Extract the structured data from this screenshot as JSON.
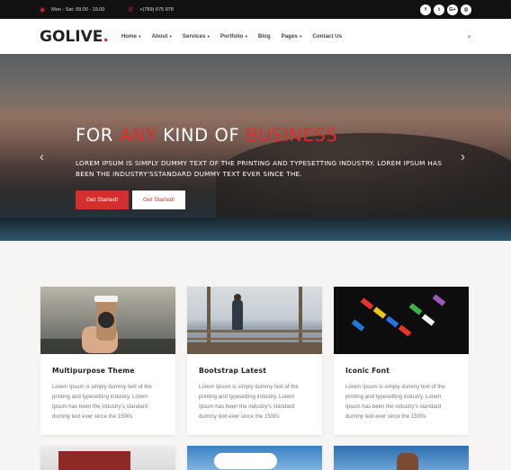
{
  "topbar": {
    "hours": "Mon - Sat: 09.00 - 19.00",
    "phone": "+(789) 675 978",
    "social": [
      {
        "icon": "facebook-icon",
        "glyph": "f"
      },
      {
        "icon": "twitter-icon",
        "glyph": "t"
      },
      {
        "icon": "google-plus-icon",
        "glyph": "G+"
      },
      {
        "icon": "dribbble-icon",
        "glyph": "◎"
      }
    ]
  },
  "header": {
    "logo_main": "GOLIVE",
    "logo_dot": ".",
    "nav": [
      {
        "label": "Home",
        "dropdown": true
      },
      {
        "label": "About",
        "dropdown": true
      },
      {
        "label": "Services",
        "dropdown": true
      },
      {
        "label": "Portfolio",
        "dropdown": true
      },
      {
        "label": "Blog",
        "dropdown": false
      },
      {
        "label": "Pages",
        "dropdown": true
      },
      {
        "label": "Contact Us",
        "dropdown": false
      }
    ]
  },
  "hero": {
    "title_1": "FOR ",
    "title_2": "ANY",
    "title_3": " KIND OF ",
    "title_4": "BUSINESS",
    "text": "LOREM IPSUM IS SIMPLY DUMMY TEXT OF THE PRINTING AND TYPESETTING INDUSTRY. LOREM IPSUM HAS BEEN THE INDUSTRY'SSTANDARD DUMMY TEXT EVER SINCE THE.",
    "btn_primary": "Get Started!",
    "btn_secondary": "Get Started!"
  },
  "cards": [
    {
      "title": "Multipurpose Theme",
      "text": "Lorem Ipsum is simply dummy text of the printing and typesetting industry. Lorem Ipsum has been the industry's standard dummy text ever since the 1500s"
    },
    {
      "title": "Bootstrap Latest",
      "text": "Lorem Ipsum is simply dummy text of the printing and typesetting industry. Lorem Ipsum has been the industry's standard dummy text ever since the 1500s"
    },
    {
      "title": "Iconic Font",
      "text": "Lorem Ipsum is simply dummy text of the printing and typesetting industry. Lorem Ipsum has been the industry's standard dummy text ever since the 1500s"
    }
  ],
  "colors": {
    "accent": "#e52b2b",
    "button": "#d32f2f",
    "topbar": "#111111"
  }
}
